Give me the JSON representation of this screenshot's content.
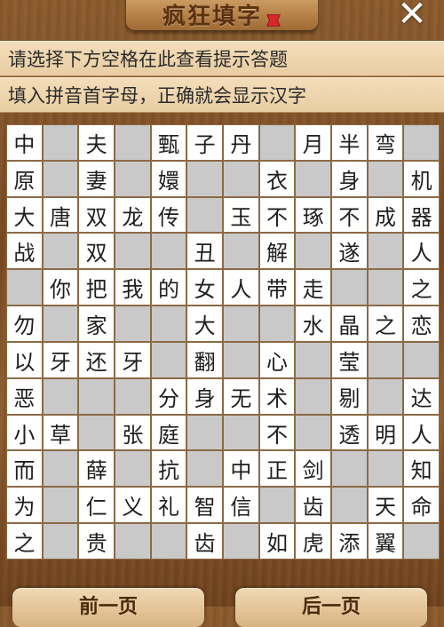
{
  "header": {
    "title": "疯狂填字",
    "close_symbol": "✕"
  },
  "hints": {
    "line1": "请选择下方空格在此查看提示答题",
    "line2": "填入拼音首字母，正确就会显示汉字"
  },
  "grid": [
    [
      "中",
      "",
      "夫",
      "",
      "甄",
      "子",
      "丹",
      "",
      "月",
      "半",
      "弯",
      ""
    ],
    [
      "原",
      "",
      "妻",
      "",
      "嬛",
      "",
      "",
      "衣",
      "",
      "身",
      "",
      "机"
    ],
    [
      "大",
      "唐",
      "双",
      "龙",
      "传",
      "",
      "玉",
      "不",
      "琢",
      "不",
      "成",
      "器"
    ],
    [
      "战",
      "",
      "双",
      "",
      "",
      "丑",
      "",
      "解",
      "",
      "遂",
      "",
      "人"
    ],
    [
      "",
      "你",
      "把",
      "我",
      "的",
      "女",
      "人",
      "带",
      "走",
      "",
      "",
      "之"
    ],
    [
      "勿",
      "",
      "家",
      "",
      "",
      "大",
      "",
      "",
      "水",
      "晶",
      "之",
      "恋"
    ],
    [
      "以",
      "牙",
      "还",
      "牙",
      "",
      "翻",
      "",
      "心",
      "",
      "莹",
      "",
      ""
    ],
    [
      "恶",
      "",
      "",
      "",
      "分",
      "身",
      "无",
      "术",
      "",
      "剔",
      "",
      "达"
    ],
    [
      "小",
      "草",
      "",
      "张",
      "庭",
      "",
      "",
      "不",
      "",
      "透",
      "明",
      "人"
    ],
    [
      "而",
      "",
      "薛",
      "",
      "抗",
      "",
      "中",
      "正",
      "剑",
      "",
      "",
      "知"
    ],
    [
      "为",
      "",
      "仁",
      "义",
      "礼",
      "智",
      "信",
      "",
      "齿",
      "",
      "天",
      "命"
    ],
    [
      "之",
      "",
      "贵",
      "",
      "",
      "齿",
      "",
      "如",
      "虎",
      "添",
      "翼",
      ""
    ]
  ],
  "footer": {
    "prev_label": "前一页",
    "next_label": "后一页"
  },
  "colors": {
    "wood": "#7a4b22",
    "hint_bg": "#f3ddb9",
    "blank_cell": "#c9c9c9",
    "filled_cell": "#ffffff"
  }
}
